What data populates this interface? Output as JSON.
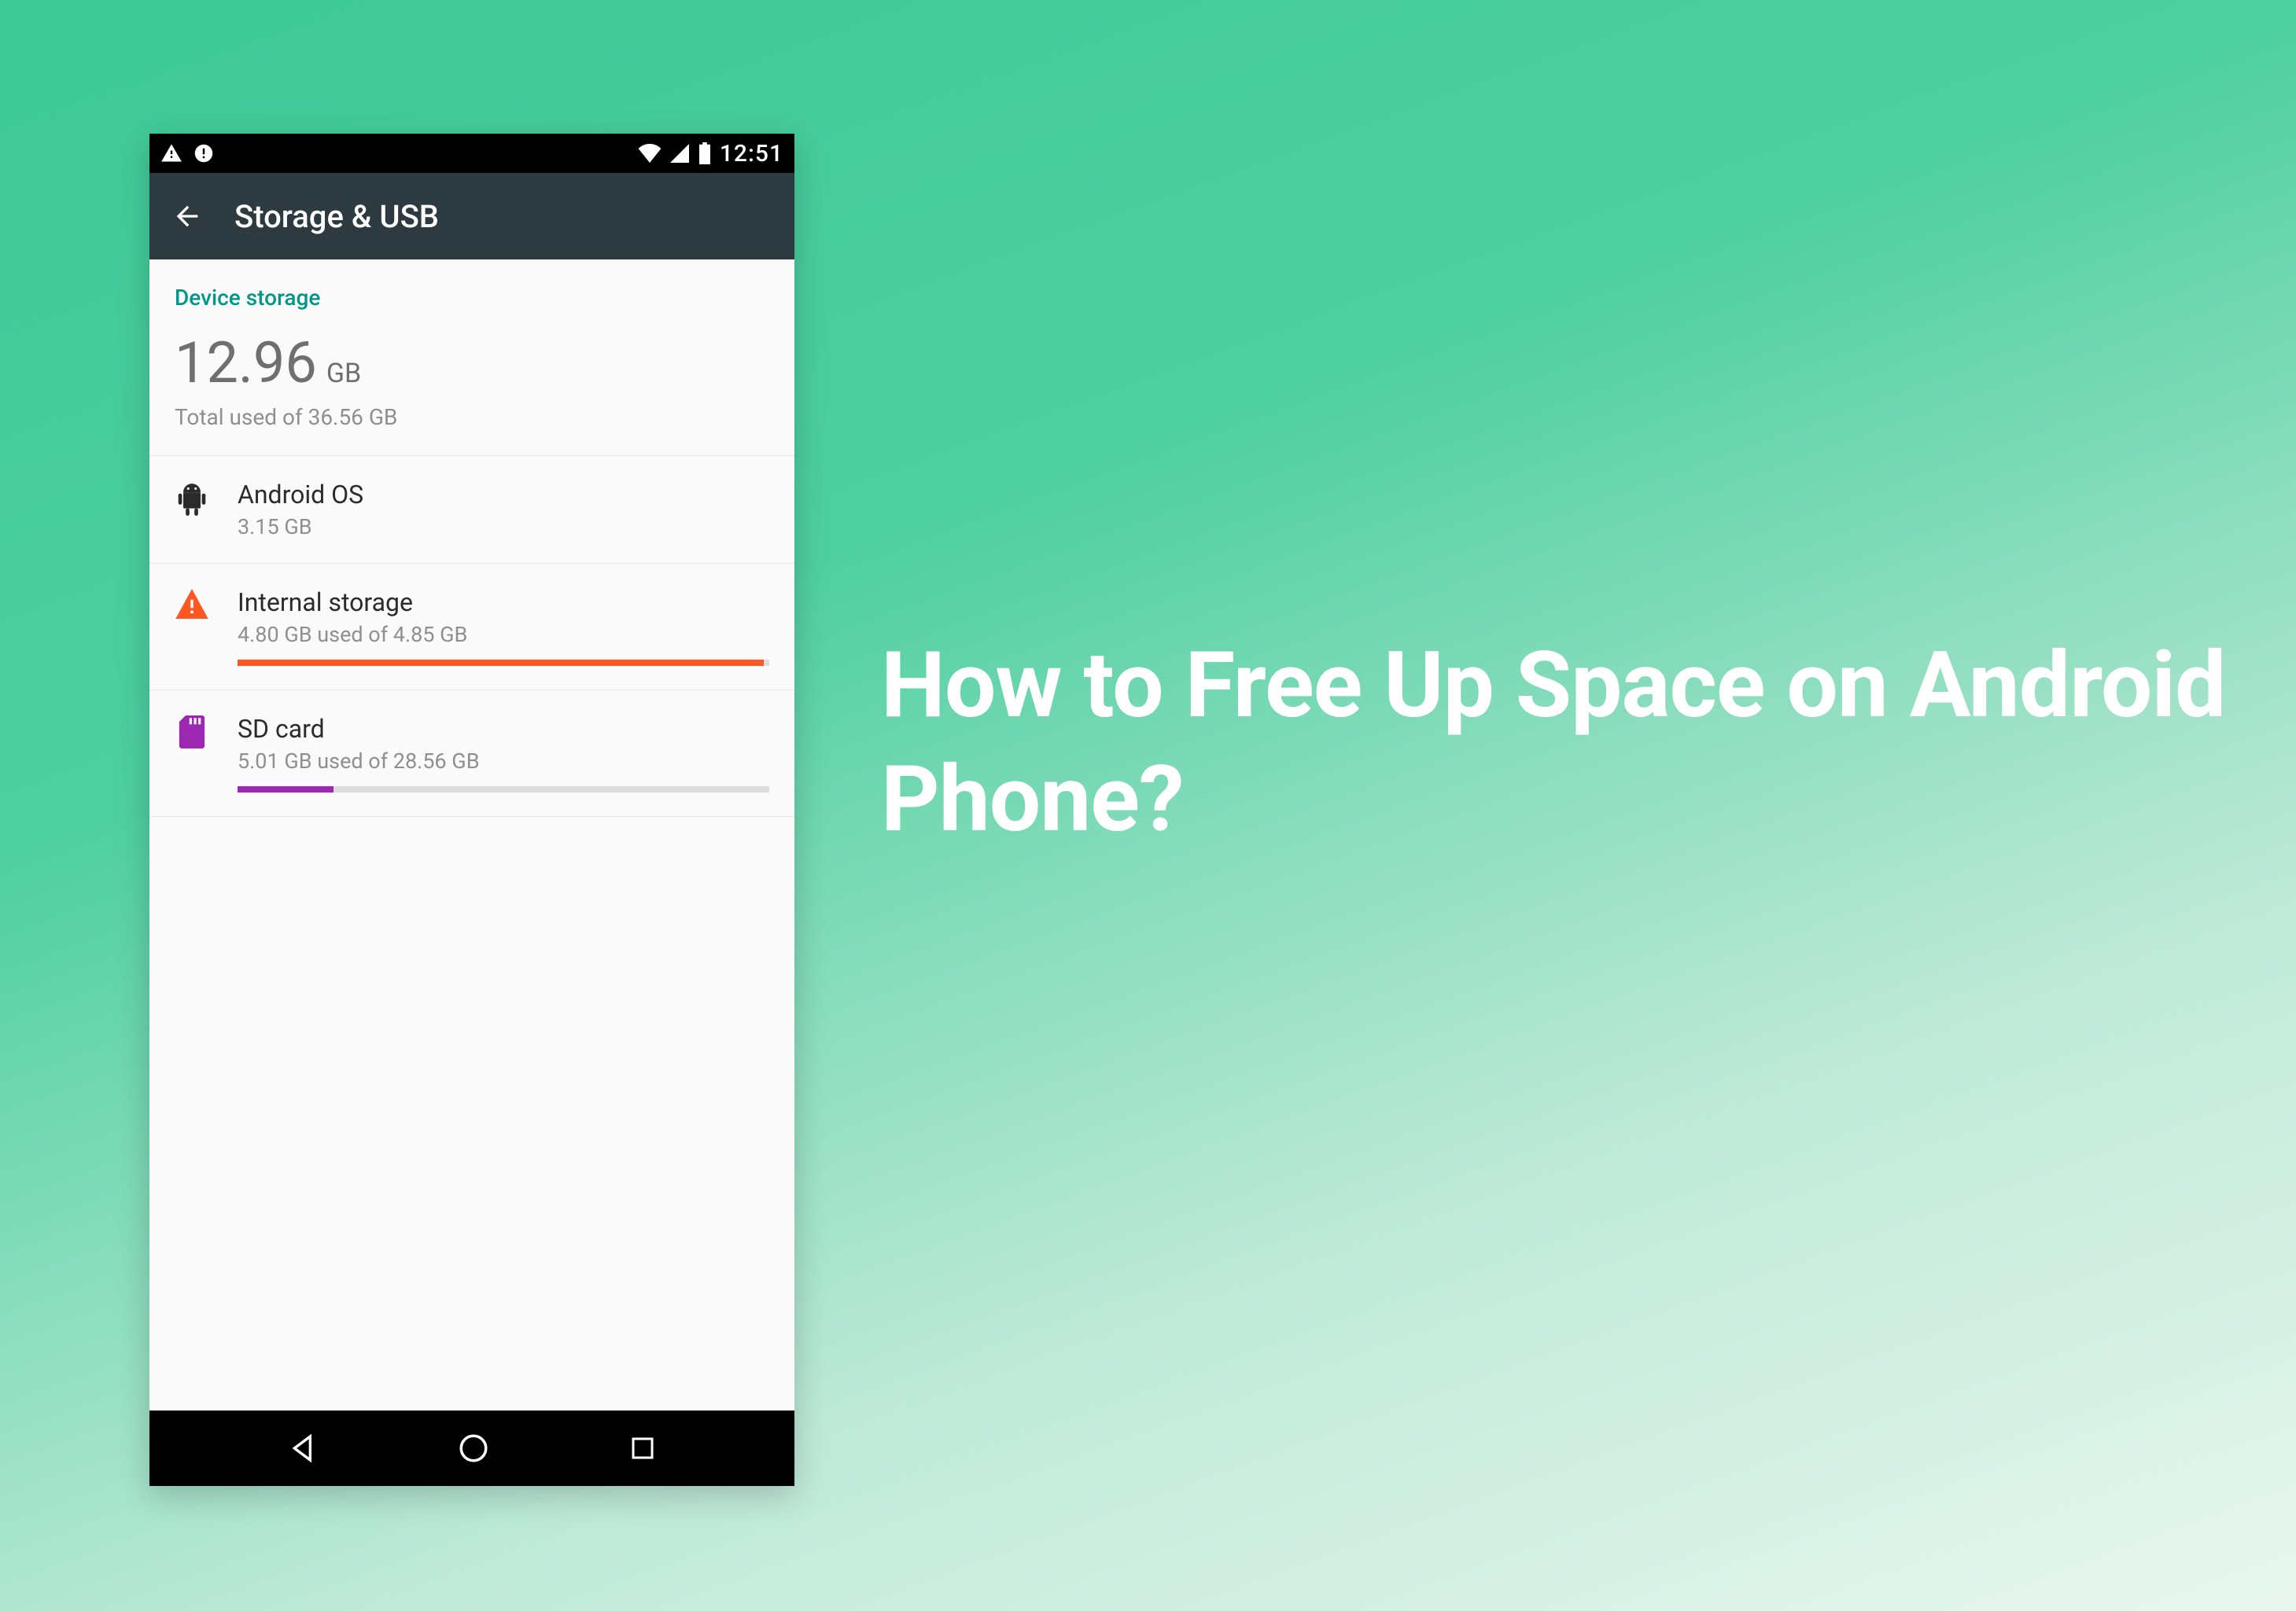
{
  "headline": "How to Free Up Space on Android Phone?",
  "status": {
    "time": "12:51"
  },
  "appbar": {
    "title": "Storage & USB"
  },
  "section_label": "Device storage",
  "summary": {
    "value": "12.96",
    "unit": "GB",
    "subtitle": "Total used of 36.56 GB"
  },
  "rows": [
    {
      "title": "Android OS",
      "subtitle": "3.15 GB"
    },
    {
      "title": "Internal storage",
      "subtitle": "4.80 GB used of 4.85 GB",
      "fill_pct": 99,
      "color": "orange"
    },
    {
      "title": "SD card",
      "subtitle": "5.01 GB used of 28.56 GB",
      "fill_pct": 18,
      "color": "purple"
    }
  ]
}
